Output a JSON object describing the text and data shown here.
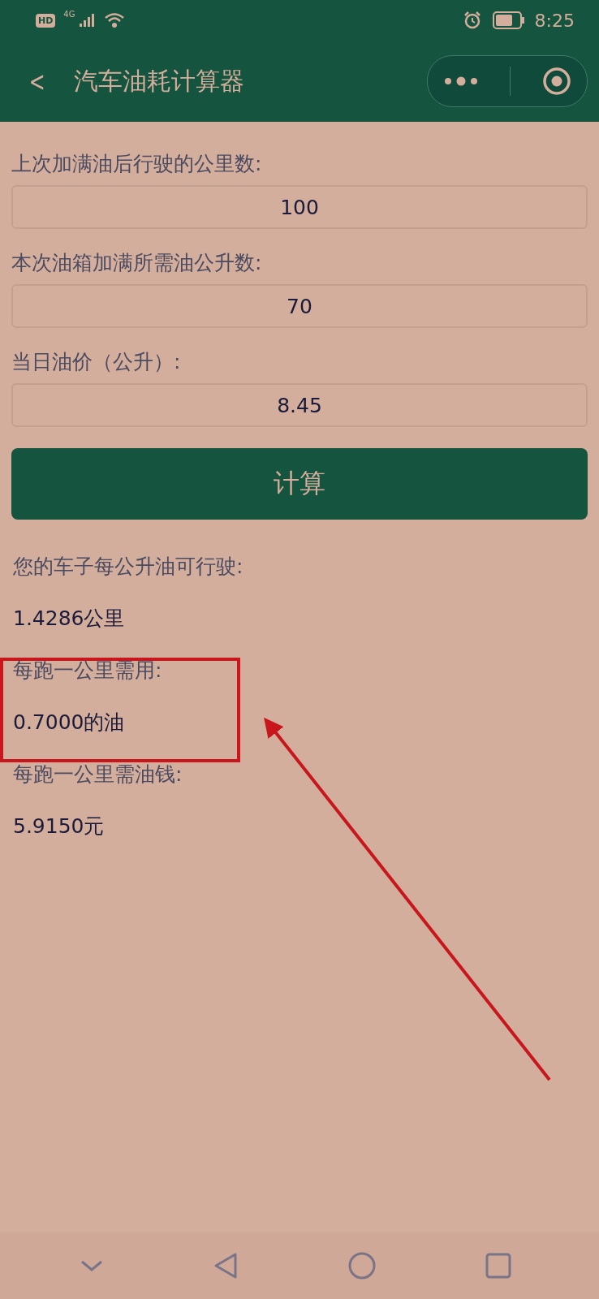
{
  "status_bar": {
    "hd": "HD",
    "network": "4G",
    "time": "8:25"
  },
  "header": {
    "back": "<",
    "title": "汽车油耗计算器"
  },
  "fields": [
    {
      "label": "上次加满油后行驶的公里数:",
      "value": "100"
    },
    {
      "label": "本次油箱加满所需油公升数:",
      "value": "70"
    },
    {
      "label": "当日油价（公升）:",
      "value": "8.45"
    }
  ],
  "button": "计算",
  "results": [
    {
      "label": "您的车子每公升油可行驶:",
      "value": "1.4286公里"
    },
    {
      "label": "每跑一公里需用:",
      "value": "0.7000的油"
    },
    {
      "label": "每跑一公里需油钱:",
      "value": "5.9150元"
    }
  ]
}
